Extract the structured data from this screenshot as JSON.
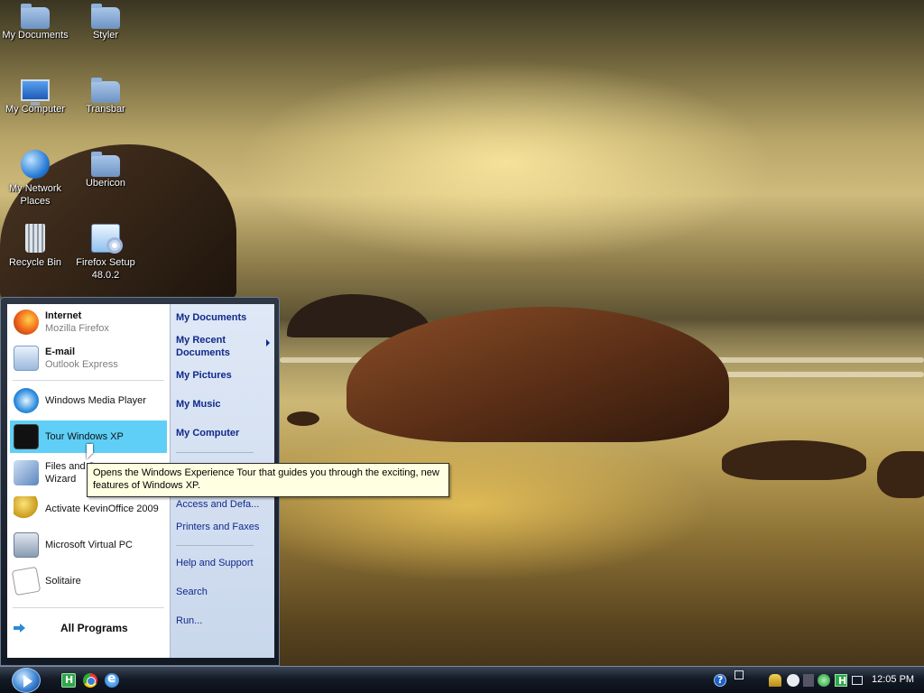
{
  "desktop": {
    "icons": [
      {
        "label": "My Documents",
        "icon": "folder-icon"
      },
      {
        "label": "Styler",
        "icon": "folder-icon"
      },
      {
        "label": "My Computer",
        "icon": "monitor-icon"
      },
      {
        "label": "Transbar",
        "icon": "folder-icon"
      },
      {
        "label": "My Network Places",
        "icon": "globe-icon"
      },
      {
        "label": "Ubericon",
        "icon": "folder-icon"
      },
      {
        "label": "Recycle Bin",
        "icon": "recycle-bin-icon"
      },
      {
        "label": "Firefox Setup 48.0.2",
        "icon": "installer-icon"
      }
    ]
  },
  "start_menu": {
    "pinned": [
      {
        "title": "Internet",
        "subtitle": "Mozilla Firefox",
        "icon": "firefox-icon"
      },
      {
        "title": "E-mail",
        "subtitle": "Outlook Express",
        "icon": "outlook-express-icon"
      }
    ],
    "programs": [
      {
        "label": "Windows Media Player",
        "icon": "media-player-icon",
        "highlighted": false
      },
      {
        "label": "Tour Windows XP",
        "icon": "tour-xp-icon",
        "highlighted": true
      },
      {
        "label": "Files and Settings Transfer Wizard",
        "line1": "Files and S",
        "line2": "Wizard",
        "icon": "transfer-wizard-icon",
        "highlighted": false
      },
      {
        "label": "Activate KevinOffice 2009",
        "icon": "key-icon",
        "highlighted": false
      },
      {
        "label": "Microsoft Virtual PC",
        "icon": "virtual-pc-icon",
        "highlighted": false
      },
      {
        "label": "Solitaire",
        "icon": "solitaire-icon",
        "highlighted": false
      }
    ],
    "all_programs": "All Programs",
    "right_links": [
      {
        "label": "My Documents",
        "bold": true
      },
      {
        "label": "My Recent Documents",
        "line1": "My Recent",
        "line2": "Documents",
        "bold": true,
        "submenu": true
      },
      {
        "label": "My Pictures",
        "bold": true
      },
      {
        "label": "My Music",
        "bold": true
      },
      {
        "label": "My Computer",
        "bold": true
      },
      {
        "label": "Access and Defa...",
        "bold": false
      },
      {
        "label": "Printers and Faxes",
        "bold": false
      },
      {
        "label": "Help and Support",
        "bold": false
      },
      {
        "label": "Search",
        "bold": false
      },
      {
        "label": "Run...",
        "bold": false
      }
    ]
  },
  "tooltip": {
    "line1": "Opens the Windows Experience Tour that guides you through the exciting, new",
    "line2": "features of Windows XP."
  },
  "taskbar": {
    "quick_launch": [
      "h-app-icon",
      "chrome-icon",
      "internet-explorer-icon"
    ],
    "tray": [
      "help-icon",
      "window-icon",
      "key-icon",
      "msn-icon",
      "network-icon",
      "globe-icon",
      "h-app-icon",
      "battery-icon"
    ],
    "clock": "12:05 PM"
  },
  "colors": {
    "highlight": "#5fcff7",
    "link_blue": "#10298a",
    "tooltip_bg": "#ffffe1"
  }
}
